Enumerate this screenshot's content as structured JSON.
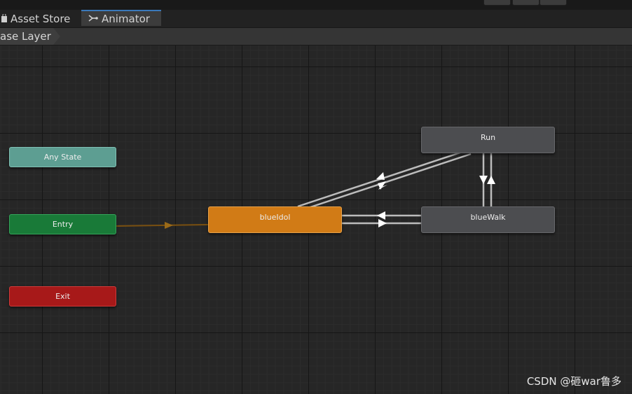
{
  "tabs": [
    {
      "label": "Asset Store",
      "active": false,
      "icon": "bag-icon"
    },
    {
      "label": "Animator",
      "active": true,
      "icon": "animator-icon"
    }
  ],
  "breadcrumb": {
    "label": "ase Layer"
  },
  "graph": {
    "nodes": {
      "any_state": {
        "label": "Any State",
        "color": "#5d9e92"
      },
      "entry": {
        "label": "Entry",
        "color": "#197a38"
      },
      "exit": {
        "label": "Exit",
        "color": "#a71919"
      },
      "blueidol": {
        "label": "blueIdol",
        "color": "#d17b16",
        "default": true
      },
      "run": {
        "label": "Run",
        "color": "#4c4d50"
      },
      "bluewalk": {
        "label": "blueWalk",
        "color": "#4c4d50"
      }
    },
    "transitions": [
      {
        "from": "Entry",
        "to": "blueIdol",
        "color": "#7a5010"
      },
      {
        "from": "blueIdol",
        "to": "Run",
        "color": "#bcbcbc"
      },
      {
        "from": "Run",
        "to": "blueIdol",
        "color": "#bcbcbc"
      },
      {
        "from": "blueIdol",
        "to": "blueWalk",
        "color": "#bcbcbc"
      },
      {
        "from": "blueWalk",
        "to": "blueIdol",
        "color": "#bcbcbc"
      },
      {
        "from": "Run",
        "to": "blueWalk",
        "color": "#bcbcbc"
      },
      {
        "from": "blueWalk",
        "to": "Run",
        "color": "#bcbcbc"
      }
    ]
  },
  "watermark": "CSDN @砸war鲁多"
}
